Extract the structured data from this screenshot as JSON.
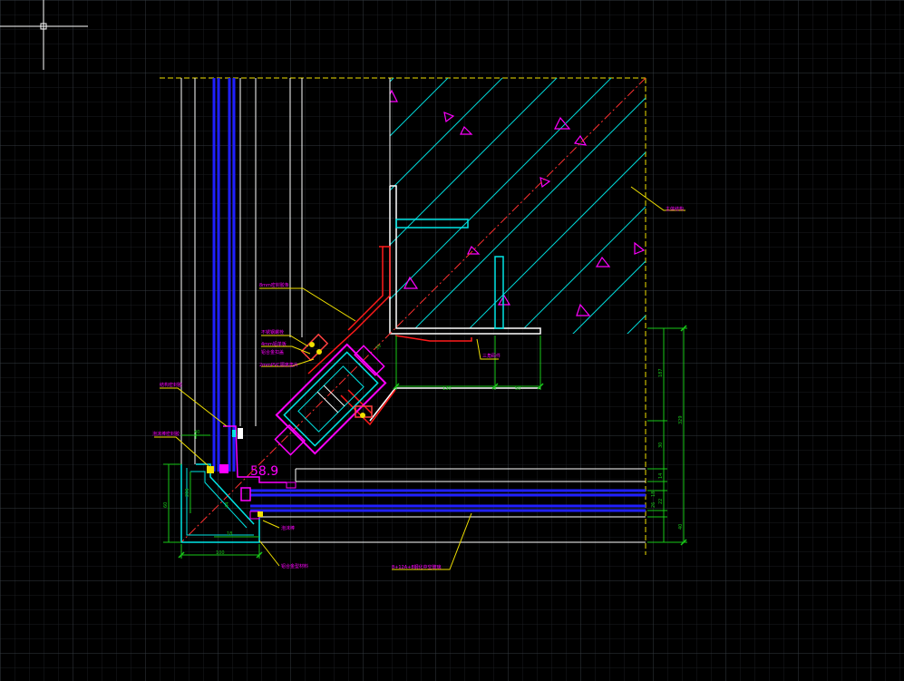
{
  "colors": {
    "background": "#000000",
    "grid_major": "#3a3f46",
    "grid_minor": "#1b1e22",
    "white": "#ffffff",
    "cyan": "#00e5e5",
    "blue": "#1f1fff",
    "magenta": "#ff00ff",
    "red": "#ff1a1a",
    "yellow": "#f0e000",
    "green": "#19c819"
  },
  "cursor": {
    "type": "crosshair",
    "icon": "crosshair-cursor-icon"
  },
  "labels": {
    "seal_strip": "8mm密封胶条",
    "bolt": "不锈钢螺栓",
    "plate_a": "4mm铝单板",
    "plate_b": "铝合金扣盖",
    "pvc_pad": "2mmPVC隔离垫片",
    "left_1": "结构密封胶",
    "left_2": "泡沫棒密封胶",
    "wall": "主体结构",
    "angle": "58.9",
    "bracket": "三角码件",
    "bottom_left": "铝合金型材料",
    "bottom_center": "8+12A+8钢化中空玻璃",
    "foam": "泡沫棒"
  },
  "dimensions": {
    "d_130": "130",
    "d_50": "50",
    "d_40": "40",
    "d_18": "18",
    "d_100": "100",
    "d_60": "60",
    "v_187": "187",
    "v_329": "329",
    "v_30": "30",
    "v_14": "14",
    "v_18": "18",
    "v_22": "22",
    "v_26": "26",
    "v_40": "40",
    "v_206": "206",
    "v_39": "39",
    "v_44": "44"
  }
}
